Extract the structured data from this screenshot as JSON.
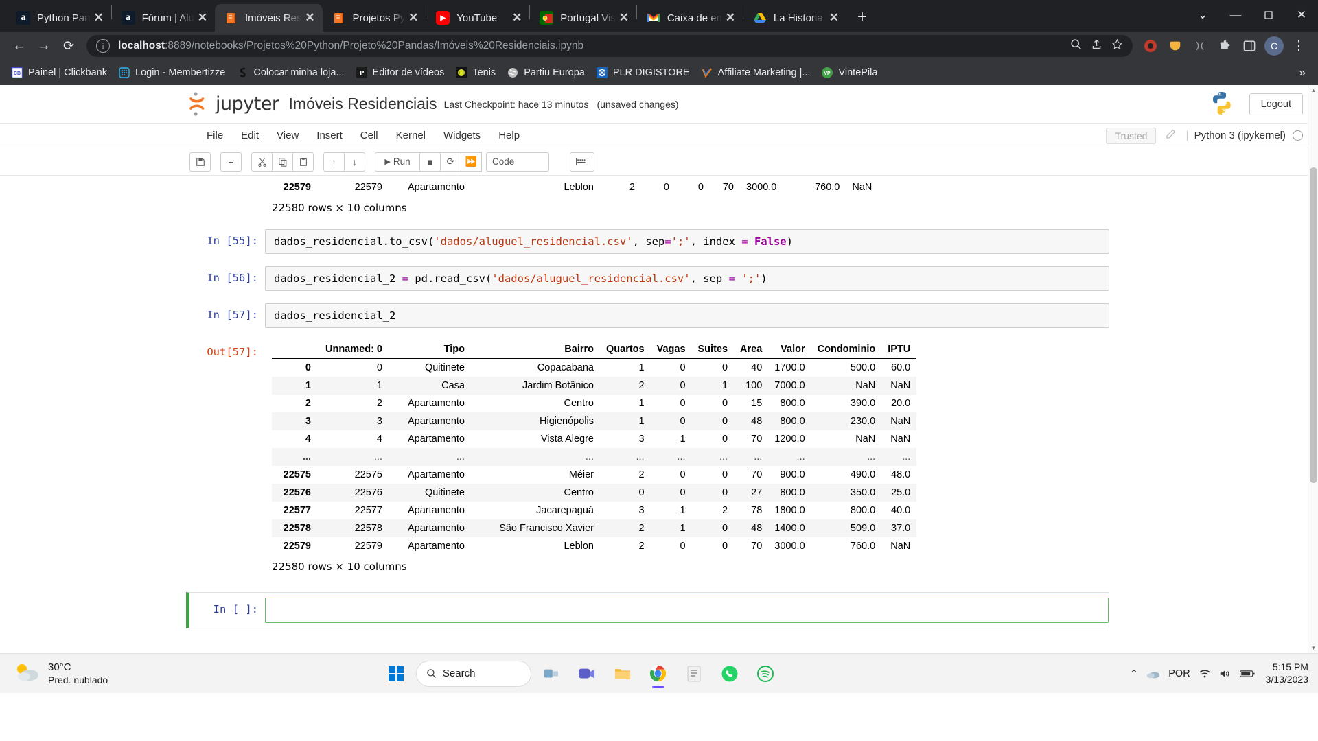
{
  "browser": {
    "tabs": [
      {
        "title": "Python Pan",
        "favicon": "alura-icon",
        "active": false
      },
      {
        "title": "Fórum | Alu",
        "favicon": "alura-icon",
        "active": false
      },
      {
        "title": "Imóveis Res",
        "favicon": "jupyter-icon",
        "active": true
      },
      {
        "title": "Projetos Py",
        "favicon": "jupyter-icon",
        "active": false
      },
      {
        "title": "YouTube",
        "favicon": "youtube-icon",
        "active": false
      },
      {
        "title": "Portugal Vis",
        "favicon": "portugal-flag-icon",
        "active": false
      },
      {
        "title": "Caixa de en",
        "favicon": "gmail-icon",
        "active": false
      },
      {
        "title": "La Historia",
        "favicon": "google-drive-icon",
        "active": false
      }
    ],
    "new_tab_label": "+",
    "close_label": "✕",
    "window_controls": {
      "minimize": "—",
      "maximize": "▢",
      "close": "✕",
      "chevron": "⌄"
    },
    "nav": {
      "back": "←",
      "forward": "→",
      "reload": "⟳"
    },
    "omnibox": {
      "host": "localhost",
      "path": ":8889/notebooks/Projetos%20Python/Projeto%20Pandas/Imóveis%20Residenciais.ipynb",
      "info_icon": "ⓘ"
    },
    "omni_actions": {
      "search": "search-icon",
      "share": "share-icon",
      "star": "star-icon"
    },
    "profile_initial": "C",
    "menu_icon": "⋮",
    "bookmarks": [
      {
        "label": "Painel | Clickbank",
        "icon": "clickbank-icon"
      },
      {
        "label": "Login - Membertizze",
        "icon": "membertizze-icon"
      },
      {
        "label": "Colocar minha loja...",
        "icon": "shopify-s-icon"
      },
      {
        "label": "Editor de vídeos",
        "icon": "editor-icon"
      },
      {
        "label": "Tenis",
        "icon": "tennis-ball-icon"
      },
      {
        "label": "Partiu Europa",
        "icon": "globe-icon"
      },
      {
        "label": "PLR DIGISTORE",
        "icon": "plr-icon"
      },
      {
        "label": "Affiliate Marketing |...",
        "icon": "checkmark-icon"
      },
      {
        "label": "VintePila",
        "icon": "vintepila-icon"
      }
    ],
    "bookmarks_overflow": "»"
  },
  "jupyter": {
    "brand": "jupyter",
    "notebook_title": "Imóveis Residenciais",
    "checkpoint": "Last Checkpoint: hace 13 minutos",
    "unsaved": "(unsaved changes)",
    "logout_label": "Logout",
    "menu": [
      "File",
      "Edit",
      "View",
      "Insert",
      "Cell",
      "Kernel",
      "Widgets",
      "Help"
    ],
    "trusted_label": "Trusted",
    "kernel_name": "Python 3 (ipykernel)",
    "toolbar": {
      "save": "save-icon",
      "add": "+",
      "cut": "scissors-icon",
      "copy": "copy-icon",
      "paste": "paste-icon",
      "move_up": "↑",
      "move_down": "↓",
      "run": "Run",
      "stop": "■",
      "restart": "⟳",
      "restart_run_all": "⏩",
      "cell_type": "Code",
      "command_palette": "keyboard-icon"
    }
  },
  "notebook": {
    "top_partial_row": {
      "index": "22579",
      "unnamed": "22579",
      "tipo": "Apartamento",
      "bairro": "Leblon",
      "quartos": "2",
      "vagas": "0",
      "suites": "0",
      "area": "70",
      "valor": "3000.0",
      "condominio": "760.0",
      "iptu": "NaN"
    },
    "top_caption": "22580 rows × 10 columns",
    "cells": [
      {
        "prompt": "In [55]:",
        "code_html": "dados_residencial.to_csv(<span class=\"tok-str\">'dados/aluguel_residencial.csv'</span>, sep<span class=\"tok-op\">=</span><span class=\"tok-str\">';'</span>, index <span class=\"tok-op\">=</span> <span class=\"tok-kw\">False</span>)"
      },
      {
        "prompt": "In [56]:",
        "code_html": "dados_residencial_2 <span class=\"tok-op\">=</span> pd.read_csv(<span class=\"tok-str\">'dados/aluguel_residencial.csv'</span>, sep <span class=\"tok-op\">=</span> <span class=\"tok-str\">';'</span>)"
      },
      {
        "prompt": "In [57]:",
        "code_html": "dados_residencial_2"
      }
    ],
    "out_prompt": "Out[57]:",
    "empty_cell_prompt": "In [ ]:",
    "bottom_caption": "22580 rows × 10 columns"
  },
  "dataframe": {
    "columns": [
      "",
      "Unnamed: 0",
      "Tipo",
      "Bairro",
      "Quartos",
      "Vagas",
      "Suites",
      "Area",
      "Valor",
      "Condominio",
      "IPTU"
    ],
    "rows": [
      [
        "0",
        "0",
        "Quitinete",
        "Copacabana",
        "1",
        "0",
        "0",
        "40",
        "1700.0",
        "500.0",
        "60.0"
      ],
      [
        "1",
        "1",
        "Casa",
        "Jardim Botânico",
        "2",
        "0",
        "1",
        "100",
        "7000.0",
        "NaN",
        "NaN"
      ],
      [
        "2",
        "2",
        "Apartamento",
        "Centro",
        "1",
        "0",
        "0",
        "15",
        "800.0",
        "390.0",
        "20.0"
      ],
      [
        "3",
        "3",
        "Apartamento",
        "Higienópolis",
        "1",
        "0",
        "0",
        "48",
        "800.0",
        "230.0",
        "NaN"
      ],
      [
        "4",
        "4",
        "Apartamento",
        "Vista Alegre",
        "3",
        "1",
        "0",
        "70",
        "1200.0",
        "NaN",
        "NaN"
      ],
      [
        "...",
        "...",
        "...",
        "...",
        "...",
        "...",
        "...",
        "...",
        "...",
        "...",
        "..."
      ],
      [
        "22575",
        "22575",
        "Apartamento",
        "Méier",
        "2",
        "0",
        "0",
        "70",
        "900.0",
        "490.0",
        "48.0"
      ],
      [
        "22576",
        "22576",
        "Quitinete",
        "Centro",
        "0",
        "0",
        "0",
        "27",
        "800.0",
        "350.0",
        "25.0"
      ],
      [
        "22577",
        "22577",
        "Apartamento",
        "Jacarepaguá",
        "3",
        "1",
        "2",
        "78",
        "1800.0",
        "800.0",
        "40.0"
      ],
      [
        "22578",
        "22578",
        "Apartamento",
        "São Francisco Xavier",
        "2",
        "1",
        "0",
        "48",
        "1400.0",
        "509.0",
        "37.0"
      ],
      [
        "22579",
        "22579",
        "Apartamento",
        "Leblon",
        "2",
        "0",
        "0",
        "70",
        "3000.0",
        "760.0",
        "NaN"
      ]
    ]
  },
  "taskbar": {
    "weather_temp": "30°C",
    "weather_desc": "Pred. nublado",
    "search_label": "Search",
    "apps": [
      {
        "name": "start-windows-button",
        "icon": "windows-icon"
      },
      {
        "name": "search-pill",
        "icon": "search-icon"
      },
      {
        "name": "task-view-button",
        "icon": "task-view-icon"
      },
      {
        "name": "teams-button",
        "icon": "teams-icon"
      },
      {
        "name": "file-explorer-button",
        "icon": "folder-icon"
      },
      {
        "name": "chrome-button",
        "icon": "chrome-icon"
      },
      {
        "name": "notepad-button",
        "icon": "notepad-icon"
      },
      {
        "name": "whatsapp-button",
        "icon": "whatsapp-icon"
      },
      {
        "name": "spotify-button",
        "icon": "spotify-icon"
      }
    ],
    "tray_chevron": "⌃",
    "language": "POR",
    "time": "5:15 PM",
    "date": "3/13/2023"
  }
}
